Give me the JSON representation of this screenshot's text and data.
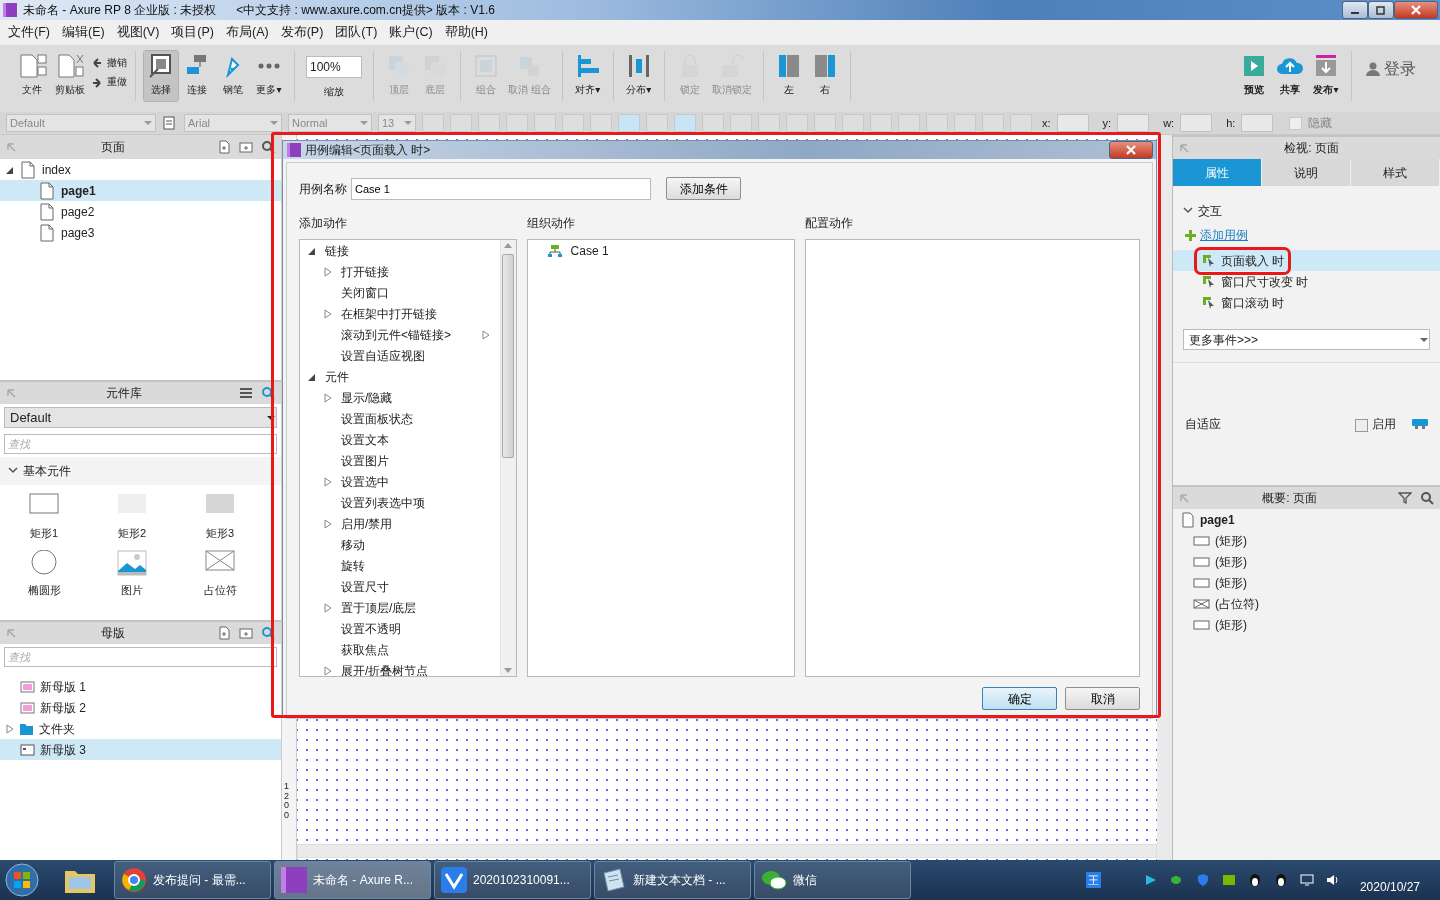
{
  "window": {
    "title": "未命名 - Axure RP 8 企业版 : 未授权",
    "subtitle": "<中文支持 : www.axure.com.cn提供> 版本 : V1.6"
  },
  "menu": [
    "文件(F)",
    "编辑(E)",
    "视图(V)",
    "项目(P)",
    "布局(A)",
    "发布(P)",
    "团队(T)",
    "账户(C)",
    "帮助(H)"
  ],
  "toolbar": {
    "groups": [
      [
        {
          "label": "文件",
          "kind": "big",
          "selected": false,
          "disabled": false
        },
        {
          "label": "剪贴板",
          "kind": "big",
          "selected": false,
          "disabled": false
        },
        {
          "label": "撤销",
          "kind": "small"
        },
        {
          "label": "重做",
          "kind": "small"
        }
      ],
      [
        {
          "label": "选择",
          "kind": "big",
          "selected": true,
          "disabled": false
        },
        {
          "label": "连接",
          "kind": "big",
          "selected": false,
          "disabled": false
        },
        {
          "label": "钢笔",
          "kind": "big",
          "selected": false,
          "disabled": false
        },
        {
          "label": "更多▾",
          "kind": "big",
          "selected": false,
          "disabled": false
        }
      ],
      [
        {
          "label": "缩放",
          "kind": "zoom",
          "value": "100%"
        }
      ],
      [
        {
          "label": "顶层",
          "kind": "big",
          "selected": false,
          "disabled": true
        },
        {
          "label": "底层",
          "kind": "big",
          "selected": false,
          "disabled": true
        }
      ],
      [
        {
          "label": "组合",
          "kind": "big",
          "selected": false,
          "disabled": true
        },
        {
          "label": "取消 组合",
          "kind": "big",
          "selected": false,
          "disabled": true
        }
      ],
      [
        {
          "label": "对齐▾",
          "kind": "big",
          "selected": false,
          "disabled": false
        }
      ],
      [
        {
          "label": "分布▾",
          "kind": "big",
          "selected": false,
          "disabled": false
        }
      ],
      [
        {
          "label": "锁定",
          "kind": "big",
          "selected": false,
          "disabled": true
        },
        {
          "label": "取消锁定",
          "kind": "big",
          "selected": false,
          "disabled": true
        }
      ],
      [
        {
          "label": "左",
          "kind": "big",
          "selected": false,
          "disabled": false
        },
        {
          "label": "右",
          "kind": "big",
          "selected": false,
          "disabled": false
        }
      ]
    ],
    "right": [
      {
        "label": "预览"
      },
      {
        "label": "共享"
      },
      {
        "label": "发布▾"
      }
    ],
    "login": "登录"
  },
  "format_bar": {
    "style": "Default",
    "font": "Arial",
    "weight": "Normal",
    "size": "13",
    "fields": [
      {
        "label": "x:"
      },
      {
        "label": "y:"
      },
      {
        "label": "w:"
      },
      {
        "label": "h:"
      }
    ],
    "hidden": {
      "label": "隐藏",
      "checked": false
    }
  },
  "pages": {
    "title": "页面",
    "tree": [
      {
        "label": "index",
        "expanded": true,
        "selected": false,
        "children": [
          {
            "label": "page1",
            "selected": true
          },
          {
            "label": "page2",
            "selected": false
          },
          {
            "label": "page3",
            "selected": false
          }
        ]
      }
    ]
  },
  "library": {
    "title": "元件库",
    "select": "Default",
    "search": {
      "placeholder": "查找"
    },
    "section": {
      "label": "基本元件",
      "expanded": true
    },
    "widgets": [
      {
        "label": "矩形1",
        "kind": "rect-outline"
      },
      {
        "label": "矩形2",
        "kind": "rect-light"
      },
      {
        "label": "矩形3",
        "kind": "rect-grey"
      },
      {
        "label": "椭圆形",
        "kind": "ellipse"
      },
      {
        "label": "图片",
        "kind": "image"
      },
      {
        "label": "占位符",
        "kind": "placeholder"
      }
    ]
  },
  "masters": {
    "title": "母版",
    "search": {
      "placeholder": "查找"
    },
    "items": [
      {
        "label": "新母版 1",
        "kind": "master",
        "selected": false
      },
      {
        "label": "新母版 2",
        "kind": "master",
        "selected": false
      },
      {
        "label": "文件夹",
        "kind": "folder",
        "expanded": false,
        "selected": false
      },
      {
        "label": "新母版 3",
        "kind": "master-alt",
        "selected": true
      }
    ]
  },
  "canvas": {
    "ruler_label": "1200"
  },
  "dialog": {
    "title": "用例编辑<页面载入 时>",
    "highlighted": true,
    "name_label": "用例名称",
    "name_value": "Case 1",
    "add_condition": "添加条件",
    "columns": [
      "添加动作",
      "组织动作",
      "配置动作"
    ],
    "actions": [
      {
        "label": "链接",
        "expanded": true,
        "children": [
          {
            "label": "打开链接",
            "expandable": true
          },
          {
            "label": "关闭窗口",
            "expandable": false
          },
          {
            "label": "在框架中打开链接",
            "expandable": true
          },
          {
            "label": "滚动到元件<锚链接>",
            "expandable": false,
            "flyout": true
          },
          {
            "label": "设置自适应视图",
            "expandable": false
          }
        ]
      },
      {
        "label": "元件",
        "expanded": true,
        "children": [
          {
            "label": "显示/隐藏",
            "expandable": true
          },
          {
            "label": "设置面板状态",
            "expandable": false
          },
          {
            "label": "设置文本",
            "expandable": false
          },
          {
            "label": "设置图片",
            "expandable": false
          },
          {
            "label": "设置选中",
            "expandable": true
          },
          {
            "label": "设置列表选中项",
            "expandable": false
          },
          {
            "label": "启用/禁用",
            "expandable": true
          },
          {
            "label": "移动",
            "expandable": false
          },
          {
            "label": "旋转",
            "expandable": false
          },
          {
            "label": "设置尺寸",
            "expandable": false
          },
          {
            "label": "置于顶层/底层",
            "expandable": true
          },
          {
            "label": "设置不透明",
            "expandable": false
          },
          {
            "label": "获取焦点",
            "expandable": false
          },
          {
            "label": "展开/折叠树节点",
            "expandable": true
          }
        ]
      }
    ],
    "organized": [
      "Case 1"
    ],
    "buttons": [
      {
        "label": "确定",
        "default": true
      },
      {
        "label": "取消",
        "default": false
      }
    ]
  },
  "inspector": {
    "title": "检视: 页面",
    "tabs": [
      {
        "label": "属性",
        "selected": true
      },
      {
        "label": "说明",
        "selected": false
      },
      {
        "label": "样式",
        "selected": false
      }
    ],
    "section": {
      "label": "交互",
      "expanded": true
    },
    "add_case": "添加用例",
    "events": [
      {
        "label": "页面载入 时",
        "selected": true,
        "highlighted": true
      },
      {
        "label": "窗口尺寸改变 时",
        "selected": false,
        "highlighted": false
      },
      {
        "label": "窗口滚动 时",
        "selected": false,
        "highlighted": false
      }
    ],
    "more_events": "更多事件>>>",
    "adaptive": {
      "label": "自适应",
      "checkbox": "启用",
      "checked": false
    }
  },
  "outline": {
    "title": "概要: 页面",
    "page": "page1",
    "items": [
      {
        "label": "(矩形)",
        "kind": "rect"
      },
      {
        "label": "(矩形)",
        "kind": "rect"
      },
      {
        "label": "(矩形)",
        "kind": "rect"
      },
      {
        "label": "(占位符)",
        "kind": "placeholder"
      },
      {
        "label": "(矩形)",
        "kind": "rect"
      }
    ]
  },
  "taskbar": {
    "items": [
      {
        "label": "发布提问 - 最需...",
        "selected": false
      },
      {
        "label": "未命名 - Axure R...",
        "selected": true
      },
      {
        "label": "2020102310091...",
        "selected": false
      },
      {
        "label": "新建文本文档 - ...",
        "selected": false
      },
      {
        "label": "微信",
        "selected": false
      }
    ],
    "tray_ime": "王",
    "date": "2020/10/27"
  }
}
